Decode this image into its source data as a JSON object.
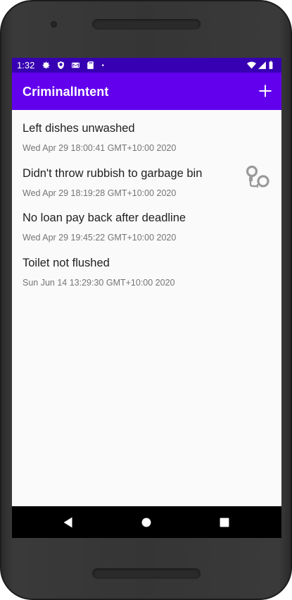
{
  "status_bar": {
    "time": "1:32",
    "left_icons": [
      "settings-icon",
      "shield-icon",
      "gmail-icon",
      "sd-card-icon",
      "dot-icon"
    ],
    "right_icons": [
      "wifi-icon",
      "signal-icon",
      "battery-icon"
    ]
  },
  "app_bar": {
    "title": "CriminalIntent",
    "add_icon": "plus-icon"
  },
  "crimes": [
    {
      "title": "Left dishes unwashed",
      "date": "Wed Apr 29 18:00:41 GMT+10:00 2020",
      "solved": false
    },
    {
      "title": "Didn't throw rubbish to garbage bin",
      "date": "Wed Apr 29 18:19:28 GMT+10:00 2020",
      "solved": true
    },
    {
      "title": "No loan pay back after deadline",
      "date": "Wed Apr 29 19:45:22 GMT+10:00 2020",
      "solved": false
    },
    {
      "title": "Toilet not flushed",
      "date": "Sun Jun 14 13:29:30 GMT+10:00 2020",
      "solved": false
    }
  ],
  "nav_bar": {
    "buttons": [
      "back-icon",
      "home-icon",
      "recents-icon"
    ]
  },
  "colors": {
    "status_bar": "#3700b3",
    "app_bar": "#6200ee",
    "list_background": "#fafafa",
    "title_text": "#1f1f1f",
    "date_text": "#757575"
  }
}
